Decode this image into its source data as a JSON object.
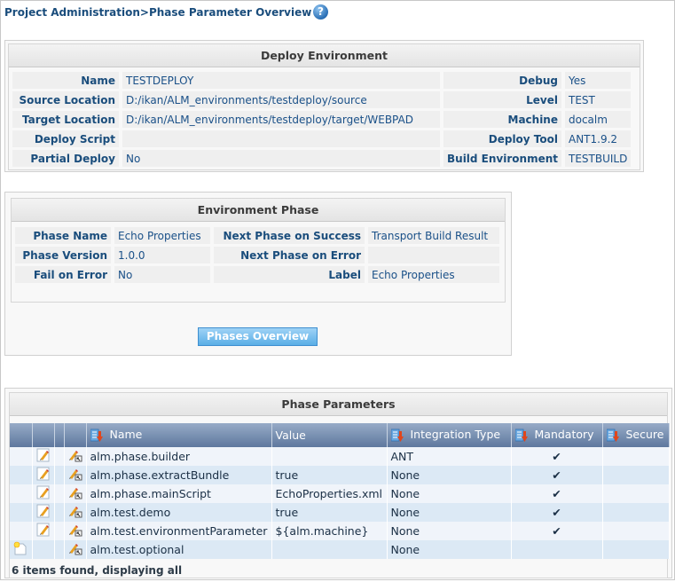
{
  "header": {
    "title": "Project Administration>Phase Parameter Overview",
    "help_icon": "help-question-icon"
  },
  "deploy_environment": {
    "title": "Deploy Environment",
    "left": [
      {
        "label": "Name",
        "value": "TESTDEPLOY"
      },
      {
        "label": "Source Location",
        "value": "D:/ikan/ALM_environments/testdeploy/source"
      },
      {
        "label": "Target Location",
        "value": "D:/ikan/ALM_environments/testdeploy/target/WEBPAD"
      },
      {
        "label": "Deploy Script",
        "value": ""
      },
      {
        "label": "Partial Deploy",
        "value": "No"
      }
    ],
    "right": [
      {
        "label": "Debug",
        "value": "Yes"
      },
      {
        "label": "Level",
        "value": "TEST"
      },
      {
        "label": "Machine",
        "value": "docalm"
      },
      {
        "label": "Deploy Tool",
        "value": "ANT1.9.2"
      },
      {
        "label": "Build Environment",
        "value": "TESTBUILD"
      }
    ]
  },
  "environment_phase": {
    "title": "Environment Phase",
    "left": [
      {
        "label": "Phase Name",
        "value": "Echo Properties"
      },
      {
        "label": "Phase Version",
        "value": "1.0.0"
      },
      {
        "label": "Fail on Error",
        "value": "No"
      }
    ],
    "right": [
      {
        "label": "Next Phase on Success",
        "value": "Transport Build Result"
      },
      {
        "label": "Next Phase on Error",
        "value": ""
      },
      {
        "label": "Label",
        "value": "Echo Properties"
      }
    ],
    "button_label": "Phases Overview"
  },
  "phase_parameters": {
    "title": "Phase Parameters",
    "columns": [
      "",
      "",
      "",
      "",
      "Name",
      "Value",
      "Integration Type",
      "Mandatory",
      "Secure"
    ],
    "rows": [
      {
        "create": false,
        "edit": true,
        "name": "alm.phase.builder",
        "value": "",
        "integration_type": "ANT",
        "mandatory": true,
        "secure": false
      },
      {
        "create": false,
        "edit": true,
        "name": "alm.phase.extractBundle",
        "value": "true",
        "integration_type": "None",
        "mandatory": true,
        "secure": false
      },
      {
        "create": false,
        "edit": true,
        "name": "alm.phase.mainScript",
        "value": "EchoProperties.xml",
        "integration_type": "None",
        "mandatory": true,
        "secure": false
      },
      {
        "create": false,
        "edit": true,
        "name": "alm.test.demo",
        "value": "true",
        "integration_type": "None",
        "mandatory": true,
        "secure": false
      },
      {
        "create": false,
        "edit": true,
        "name": "alm.test.environmentParameter",
        "value": "${alm.machine}",
        "integration_type": "None",
        "mandatory": true,
        "secure": false
      },
      {
        "create": true,
        "edit": false,
        "name": "alm.test.optional",
        "value": "",
        "integration_type": "None",
        "mandatory": false,
        "secure": false
      }
    ],
    "footer": "6 items found, displaying all",
    "check_glyph": "✔"
  }
}
